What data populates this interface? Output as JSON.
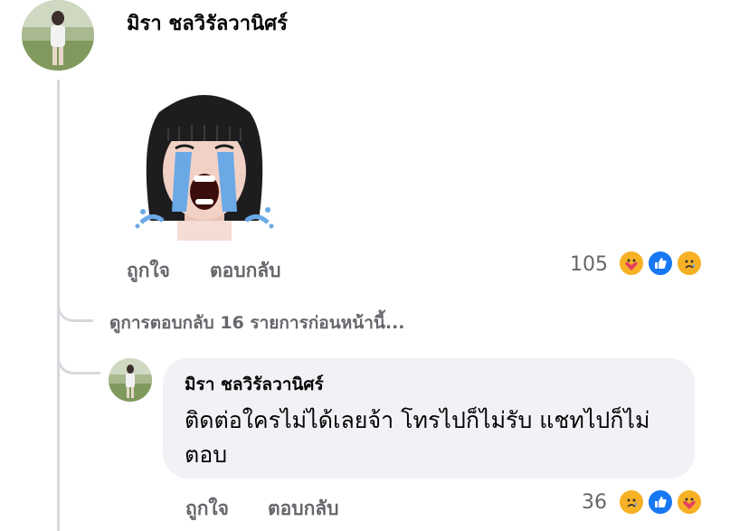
{
  "comment": {
    "author": "มิรา ชลวิรัลวานิศร์",
    "sticker": "crying-girl-sticker",
    "actions": {
      "like": "ถูกใจ",
      "reply": "ตอบกลับ"
    },
    "reactions": {
      "count": "105",
      "icons": [
        "care-reaction",
        "like-reaction",
        "sad-reaction"
      ]
    }
  },
  "view_more_replies": "ดูการตอบกลับ 16 รายการก่อนหน้านี้...",
  "reply": {
    "author": "มิรา ชลวิรัลวานิศร์",
    "text_line1": "ติดต่อใครไม่ได้เลยจ้า โทรไปก็ไม่รับ แชทไปก็ไม่",
    "text_line2": "ตอบ",
    "actions": {
      "like": "ถูกใจ",
      "reply": "ตอบกลับ"
    },
    "reactions": {
      "count": "36",
      "icons": [
        "sad-reaction",
        "like-reaction",
        "care-reaction"
      ]
    }
  },
  "colors": {
    "meta_text": "#65676b",
    "bubble_bg": "#f0f2f5",
    "like_blue": "#1877f2",
    "reaction_yellow": "#f7b125"
  }
}
